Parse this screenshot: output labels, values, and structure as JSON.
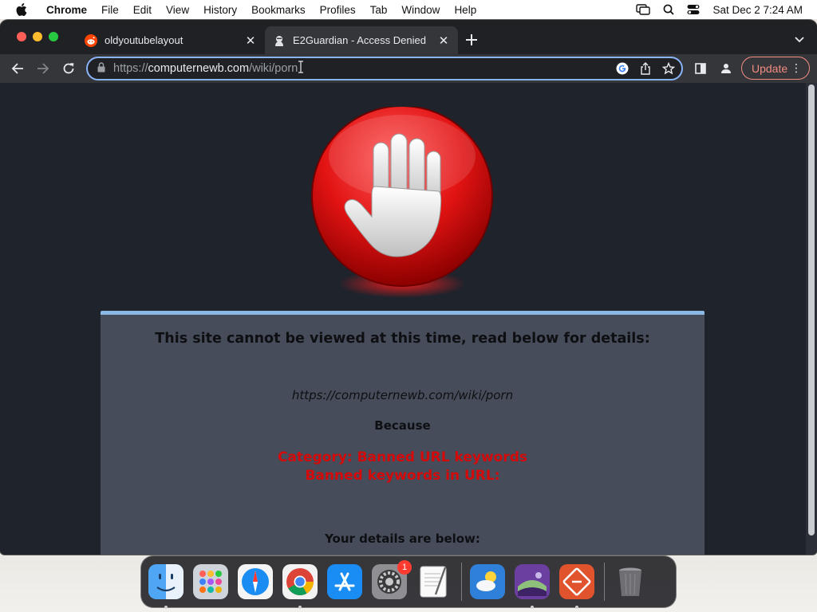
{
  "menubar": {
    "app": "Chrome",
    "items": [
      "File",
      "Edit",
      "View",
      "History",
      "Bookmarks",
      "Profiles",
      "Tab",
      "Window",
      "Help"
    ],
    "datetime": "Sat Dec 2  7:24 AM"
  },
  "tabs": [
    {
      "title": "oldyoutubelayout",
      "favicon": "reddit-icon",
      "active": false
    },
    {
      "title": "E2Guardian - Access Denied",
      "favicon": "guardian-icon",
      "active": true
    }
  ],
  "toolbar": {
    "url_scheme": "https://",
    "url_host": "computernewb.com",
    "url_path": "/wiki/porn",
    "update_label": "Update"
  },
  "page": {
    "headline": "This site cannot be viewed at this time, read below for details:",
    "blocked_url": "https://computernewb.com/wiki/porn",
    "because": "Because",
    "category": "Category: Banned URL keywords",
    "reason": "Banned keywords in URL:",
    "details_heading": "Your details are below:"
  },
  "dock": {
    "items": [
      "finder-icon",
      "launchpad-icon",
      "safari-icon",
      "chrome-icon",
      "app-store-icon",
      "system-settings-icon",
      "textedit-icon",
      "weather-icon",
      "vm-app-icon",
      "remote-desktop-icon",
      "trash-icon"
    ],
    "system_settings_badge": "1"
  },
  "colors": {
    "page_bg": "#1f232c",
    "panel_bg": "#464c59",
    "panel_border": "#8cb8e6",
    "reason_red": "#d40a0a",
    "update_accent": "#f28b82"
  }
}
